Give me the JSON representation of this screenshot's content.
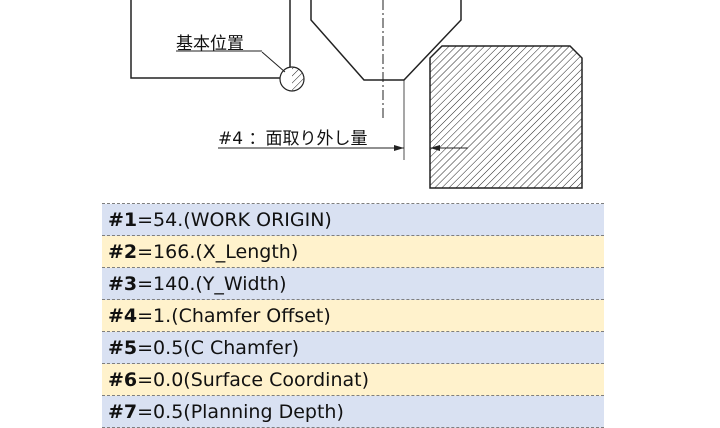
{
  "diagram": {
    "origin_label": "基本位置",
    "chamfer_label": "#4 ：面取り外し量"
  },
  "params": [
    {
      "var": "#1",
      "text": "=54.(WORK ORIGIN)",
      "color": "#d9e1f2"
    },
    {
      "var": "#2",
      "text": "=166.(X_Length)",
      "color": "#fff2cc"
    },
    {
      "var": "#3",
      "text": "=140.(Y_Width)",
      "color": "#d9e1f2"
    },
    {
      "var": "#4",
      "text": "=1.(Chamfer Offset)",
      "color": "#fff2cc"
    },
    {
      "var": "#5",
      "text": "=0.5(C Chamfer)",
      "color": "#d9e1f2"
    },
    {
      "var": "#6",
      "text": "=0.0(Surface Coordinat)",
      "color": "#fff2cc"
    },
    {
      "var": "#7",
      "text": "=0.5(Planning Depth)",
      "color": "#d9e1f2"
    }
  ]
}
